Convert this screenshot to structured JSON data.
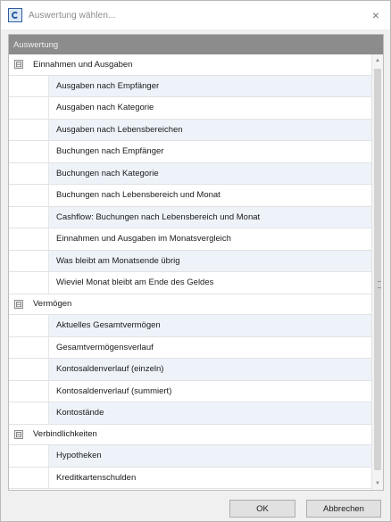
{
  "window": {
    "title": "Auswertung wählen...",
    "close_glyph": "×",
    "icon": "app-report-icon"
  },
  "grid": {
    "column_header": "Auswertung",
    "groups": [
      {
        "label": "Einnahmen und Ausgaben",
        "toggle": "⊟",
        "items": [
          "Ausgaben nach Empfänger",
          "Ausgaben nach Kategorie",
          "Ausgaben nach Lebensbereichen",
          "Buchungen nach Empfänger",
          "Buchungen nach Kategorie",
          "Buchungen nach Lebensbereich und Monat",
          "Cashflow: Buchungen nach Lebensbereich und Monat",
          "Einnahmen und Ausgaben im Monatsvergleich",
          "Was bleibt am Monatsende übrig",
          "Wieviel Monat bleibt am Ende des Geldes"
        ]
      },
      {
        "label": "Vermögen",
        "toggle": "⊟",
        "items": [
          "Aktuelles Gesamtvermögen",
          "Gesamtvermögensverlauf",
          "Kontosaldenverlauf (einzeln)",
          "Kontosaldenverlauf (summiert)",
          "Kontostände"
        ]
      },
      {
        "label": "Verbindlichkeiten",
        "toggle": "⊟",
        "items": [
          "Hypotheken",
          "Kreditkartenschulden"
        ]
      }
    ]
  },
  "scrollbar": {
    "up_glyph": "▲",
    "down_glyph": "▼"
  },
  "buttons": {
    "ok": "OK",
    "cancel": "Abbrechen"
  },
  "colors": {
    "header_bg": "#8c8c8c",
    "alt_row_bg": "#eef3fa",
    "window_bg": "#f0f0f0"
  }
}
